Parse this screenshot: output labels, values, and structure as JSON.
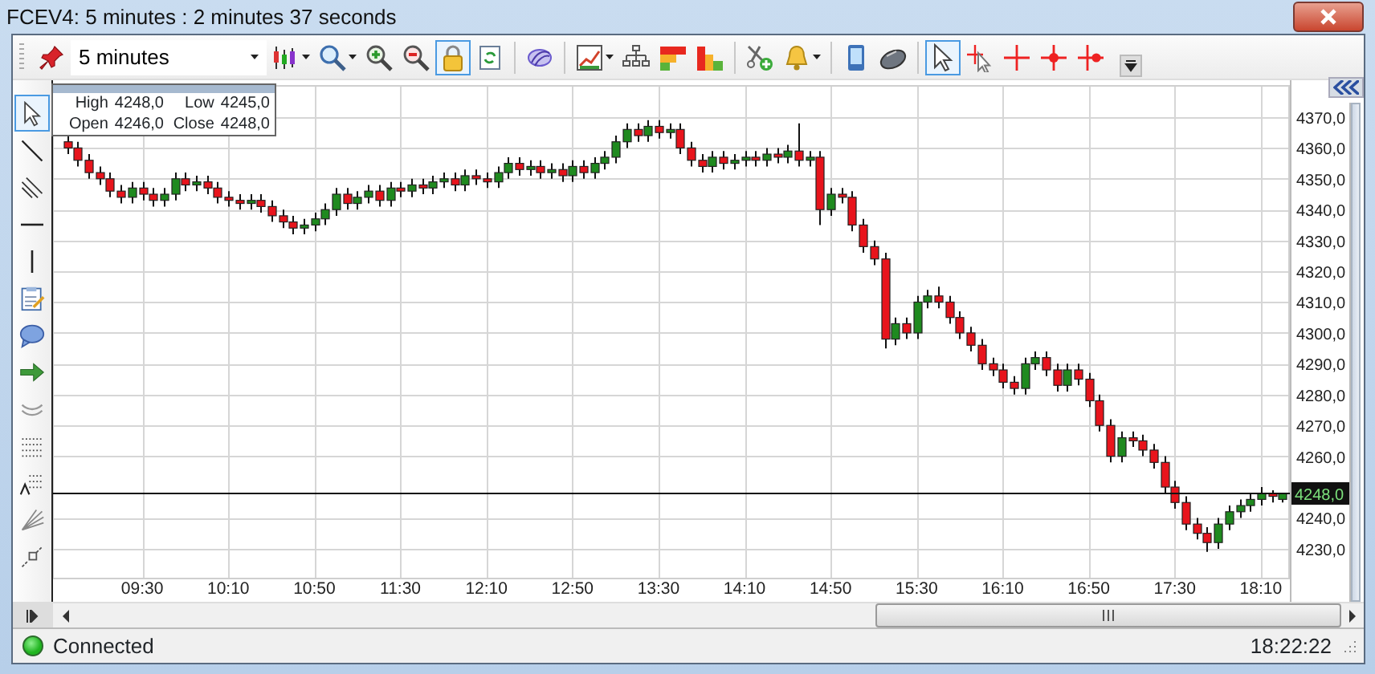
{
  "window": {
    "title": "FCEV4: 5 minutes : 2 minutes 37 seconds"
  },
  "toolbar": {
    "groups": [
      [
        {
          "kind": "pin",
          "selected": false,
          "menu": false
        },
        {
          "kind": "interval",
          "text": "5 minutes",
          "menu": true
        },
        {
          "kind": "candles",
          "selected": false,
          "menu": true
        },
        {
          "kind": "search",
          "selected": false,
          "menu": true
        },
        {
          "kind": "zoomin",
          "selected": false,
          "menu": false
        },
        {
          "kind": "zoomout",
          "selected": false,
          "menu": false
        },
        {
          "kind": "lock",
          "selected": true,
          "menu": false
        },
        {
          "kind": "refresh",
          "selected": false,
          "menu": false
        }
      ],
      [
        {
          "kind": "swirl",
          "selected": false,
          "menu": false
        }
      ],
      [
        {
          "kind": "template",
          "selected": false,
          "menu": true
        },
        {
          "kind": "tree",
          "selected": false,
          "menu": false
        },
        {
          "kind": "heat",
          "selected": false,
          "menu": false
        },
        {
          "kind": "bars",
          "selected": false,
          "menu": false
        }
      ],
      [
        {
          "kind": "scissors",
          "selected": false,
          "menu": false
        },
        {
          "kind": "bell",
          "selected": false,
          "menu": true
        }
      ],
      [
        {
          "kind": "phone",
          "selected": false,
          "menu": false
        },
        {
          "kind": "mouse",
          "selected": false,
          "menu": false
        }
      ],
      [
        {
          "kind": "cursor",
          "selected": true,
          "menu": false
        },
        {
          "kind": "cursorcross",
          "selected": false,
          "menu": false
        },
        {
          "kind": "cross",
          "selected": false,
          "menu": false
        },
        {
          "kind": "crossdot",
          "selected": false,
          "menu": false
        },
        {
          "kind": "crossdotr",
          "selected": false,
          "menu": false
        }
      ]
    ]
  },
  "drawing_tools": [
    {
      "kind": "cursor",
      "selected": true
    },
    {
      "kind": "line",
      "selected": false
    },
    {
      "kind": "parallel",
      "selected": false
    },
    {
      "kind": "hline",
      "selected": false
    },
    {
      "kind": "vline",
      "selected": false
    },
    {
      "kind": "note",
      "selected": false
    },
    {
      "kind": "bubble",
      "selected": false
    },
    {
      "kind": "arrow",
      "selected": false
    },
    {
      "kind": "arcs",
      "selected": false
    },
    {
      "kind": "dots",
      "selected": false
    },
    {
      "kind": "fib",
      "selected": false
    },
    {
      "kind": "fan",
      "selected": false
    },
    {
      "kind": "ruler",
      "selected": false
    }
  ],
  "info_box": {
    "rows": [
      [
        {
          "label": "High",
          "value": "4248,0"
        },
        {
          "label": "Low",
          "value": "4245,0"
        }
      ],
      [
        {
          "label": "Open",
          "value": "4246,0"
        },
        {
          "label": "Close",
          "value": "4248,0"
        }
      ]
    ]
  },
  "chart": {
    "chart_data": {
      "type": "candlestick",
      "grid": true,
      "ylim": [
        4220.6,
        4380.4
      ],
      "yticks": [
        {
          "value": 4370,
          "label": "4370,0"
        },
        {
          "value": 4360,
          "label": "4360,0"
        },
        {
          "value": 4350,
          "label": "4350,0"
        },
        {
          "value": 4340,
          "label": "4340,0"
        },
        {
          "value": 4330,
          "label": "4330,0"
        },
        {
          "value": 4320,
          "label": "4320,0"
        },
        {
          "value": 4310,
          "label": "4310,0"
        },
        {
          "value": 4300,
          "label": "4300,0"
        },
        {
          "value": 4290,
          "label": "4290,0"
        },
        {
          "value": 4280,
          "label": "4280,0"
        },
        {
          "value": 4270,
          "label": "4270,0"
        },
        {
          "value": 4260,
          "label": "4260,0"
        },
        {
          "value": 4240,
          "label": "4240,0"
        },
        {
          "value": 4230,
          "label": "4230,0"
        }
      ],
      "ref_lines": [
        {
          "axis": "y",
          "value": 4248,
          "label": "4248,0"
        }
      ],
      "categories": [
        null,
        null,
        null,
        null,
        null,
        null,
        null,
        "09:30",
        null,
        null,
        null,
        null,
        null,
        null,
        null,
        "10:10",
        null,
        null,
        null,
        null,
        null,
        null,
        null,
        "10:50",
        null,
        null,
        null,
        null,
        null,
        null,
        null,
        "11:30",
        null,
        null,
        null,
        null,
        null,
        null,
        null,
        "12:10",
        null,
        null,
        null,
        null,
        null,
        null,
        null,
        "12:50",
        null,
        null,
        null,
        null,
        null,
        null,
        null,
        "13:30",
        null,
        null,
        null,
        null,
        null,
        null,
        null,
        "14:10",
        null,
        null,
        null,
        null,
        null,
        null,
        null,
        "14:50",
        null,
        null,
        null,
        null,
        null,
        null,
        null,
        "15:30",
        null,
        null,
        null,
        null,
        null,
        null,
        null,
        "16:10",
        null,
        null,
        null,
        null,
        null,
        null,
        null,
        "16:50",
        null,
        null,
        null,
        null,
        null,
        null,
        null,
        "17:30",
        null,
        null,
        null,
        null,
        null,
        null,
        null,
        "18:10",
        null,
        null
      ],
      "ohlc": [
        [
          4362,
          4364,
          4358,
          4360
        ],
        [
          4360,
          4362,
          4354,
          4356
        ],
        [
          4356,
          4358,
          4350,
          4352
        ],
        [
          4352,
          4354,
          4348,
          4350
        ],
        [
          4350,
          4352,
          4344,
          4346
        ],
        [
          4346,
          4348,
          4342,
          4344
        ],
        [
          4344,
          4349,
          4342,
          4347
        ],
        [
          4347,
          4349,
          4343,
          4345
        ],
        [
          4345,
          4347,
          4341,
          4343
        ],
        [
          4343,
          4347,
          4341,
          4345
        ],
        [
          4345,
          4352,
          4343,
          4350
        ],
        [
          4350,
          4352,
          4346,
          4348
        ],
        [
          4348,
          4351,
          4346,
          4349
        ],
        [
          4349,
          4351,
          4345,
          4347
        ],
        [
          4347,
          4349,
          4342,
          4344
        ],
        [
          4344,
          4346,
          4341,
          4343
        ],
        [
          4343,
          4345,
          4340,
          4342
        ],
        [
          4342,
          4345,
          4340,
          4343
        ],
        [
          4343,
          4345,
          4339,
          4341
        ],
        [
          4341,
          4343,
          4336,
          4338
        ],
        [
          4338,
          4340,
          4334,
          4336
        ],
        [
          4336,
          4338,
          4332,
          4334
        ],
        [
          4334,
          4337,
          4332,
          4335
        ],
        [
          4335,
          4339,
          4333,
          4337
        ],
        [
          4337,
          4342,
          4335,
          4340
        ],
        [
          4340,
          4347,
          4338,
          4345
        ],
        [
          4345,
          4347,
          4340,
          4342
        ],
        [
          4342,
          4346,
          4340,
          4344
        ],
        [
          4344,
          4348,
          4342,
          4346
        ],
        [
          4346,
          4348,
          4341,
          4343
        ],
        [
          4343,
          4349,
          4341,
          4347
        ],
        [
          4347,
          4349,
          4344,
          4346
        ],
        [
          4346,
          4350,
          4344,
          4348
        ],
        [
          4348,
          4350,
          4345,
          4347
        ],
        [
          4347,
          4351,
          4345,
          4349
        ],
        [
          4349,
          4352,
          4347,
          4350
        ],
        [
          4350,
          4352,
          4346,
          4348
        ],
        [
          4348,
          4353,
          4346,
          4351
        ],
        [
          4351,
          4353,
          4348,
          4350
        ],
        [
          4350,
          4352,
          4347,
          4349
        ],
        [
          4349,
          4354,
          4347,
          4352
        ],
        [
          4352,
          4357,
          4350,
          4355
        ],
        [
          4355,
          4357,
          4351,
          4353
        ],
        [
          4353,
          4356,
          4351,
          4354
        ],
        [
          4354,
          4356,
          4350,
          4352
        ],
        [
          4352,
          4355,
          4350,
          4353
        ],
        [
          4353,
          4355,
          4349,
          4351
        ],
        [
          4351,
          4356,
          4349,
          4354
        ],
        [
          4354,
          4356,
          4350,
          4352
        ],
        [
          4352,
          4357,
          4350,
          4355
        ],
        [
          4355,
          4359,
          4353,
          4357
        ],
        [
          4357,
          4364,
          4355,
          4362
        ],
        [
          4362,
          4368,
          4360,
          4366
        ],
        [
          4366,
          4368,
          4362,
          4364
        ],
        [
          4364,
          4369,
          4362,
          4367
        ],
        [
          4367,
          4369,
          4363,
          4365
        ],
        [
          4365,
          4368,
          4363,
          4366
        ],
        [
          4366,
          4368,
          4358,
          4360
        ],
        [
          4360,
          4362,
          4354,
          4356
        ],
        [
          4356,
          4358,
          4352,
          4354
        ],
        [
          4354,
          4359,
          4352,
          4357
        ],
        [
          4357,
          4359,
          4353,
          4355
        ],
        [
          4355,
          4358,
          4353,
          4356
        ],
        [
          4356,
          4359,
          4354,
          4357
        ],
        [
          4357,
          4359,
          4354,
          4356
        ],
        [
          4356,
          4360,
          4354,
          4358
        ],
        [
          4358,
          4360,
          4355,
          4357
        ],
        [
          4357,
          4361,
          4355,
          4359
        ],
        [
          4359,
          4368,
          4354,
          4356
        ],
        [
          4356,
          4359,
          4354,
          4357
        ],
        [
          4357,
          4359,
          4335,
          4340
        ],
        [
          4340,
          4347,
          4338,
          4345
        ],
        [
          4345,
          4347,
          4342,
          4344
        ],
        [
          4344,
          4346,
          4333,
          4335
        ],
        [
          4335,
          4337,
          4326,
          4328
        ],
        [
          4328,
          4330,
          4322,
          4324
        ],
        [
          4324,
          4326,
          4295,
          4298
        ],
        [
          4298,
          4305,
          4296,
          4303
        ],
        [
          4303,
          4305,
          4298,
          4300
        ],
        [
          4300,
          4312,
          4298,
          4310
        ],
        [
          4310,
          4314,
          4308,
          4312
        ],
        [
          4312,
          4315,
          4308,
          4310
        ],
        [
          4310,
          4312,
          4303,
          4305
        ],
        [
          4305,
          4307,
          4298,
          4300
        ],
        [
          4300,
          4302,
          4294,
          4296
        ],
        [
          4296,
          4298,
          4288,
          4290
        ],
        [
          4290,
          4292,
          4286,
          4288
        ],
        [
          4288,
          4290,
          4282,
          4284
        ],
        [
          4284,
          4286,
          4280,
          4282
        ],
        [
          4282,
          4292,
          4280,
          4290
        ],
        [
          4290,
          4294,
          4288,
          4292
        ],
        [
          4292,
          4294,
          4286,
          4288
        ],
        [
          4288,
          4290,
          4281,
          4283
        ],
        [
          4283,
          4290,
          4281,
          4288
        ],
        [
          4288,
          4290,
          4283,
          4285
        ],
        [
          4285,
          4287,
          4276,
          4278
        ],
        [
          4278,
          4280,
          4268,
          4270
        ],
        [
          4270,
          4272,
          4258,
          4260
        ],
        [
          4260,
          4268,
          4258,
          4266
        ],
        [
          4266,
          4268,
          4263,
          4265
        ],
        [
          4265,
          4267,
          4260,
          4262
        ],
        [
          4262,
          4264,
          4256,
          4258
        ],
        [
          4258,
          4260,
          4248,
          4250
        ],
        [
          4250,
          4252,
          4243,
          4245
        ],
        [
          4245,
          4247,
          4236,
          4238
        ],
        [
          4238,
          4240,
          4233,
          4235
        ],
        [
          4235,
          4237,
          4229,
          4232
        ],
        [
          4232,
          4240,
          4230,
          4238
        ],
        [
          4238,
          4244,
          4236,
          4242
        ],
        [
          4242,
          4246,
          4240,
          4244
        ],
        [
          4244,
          4248,
          4242,
          4246
        ],
        [
          4246,
          4250,
          4244,
          4248
        ],
        [
          4248,
          4249,
          4245,
          4247
        ],
        [
          4246,
          4248,
          4245,
          4248
        ]
      ]
    }
  },
  "status_bar": {
    "text": "Connected",
    "online": true,
    "time": "18:22:22"
  }
}
